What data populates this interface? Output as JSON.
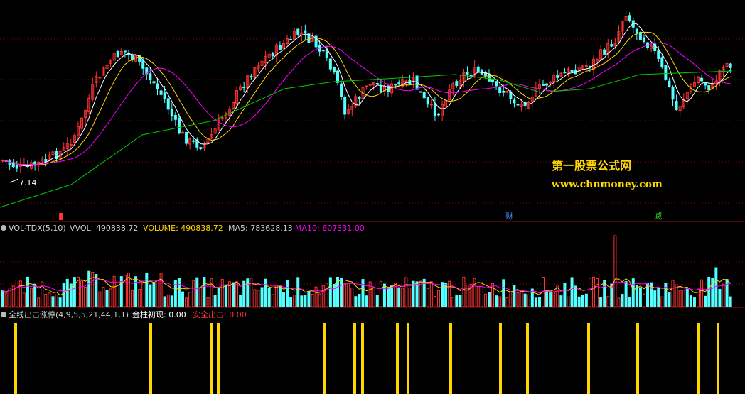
{
  "colors": {
    "background": "#000000",
    "up": "#ff3333",
    "down": "#54ffff",
    "ma_white": "#ffffff",
    "ma_yellow": "#ffd700",
    "ma_magenta": "#ff00ff",
    "ma_green": "#00cc00",
    "grid": "#8b0000",
    "separator": "#9e1010",
    "signal": "#ffd700"
  },
  "watermark": {
    "name": "第一股票公式网",
    "url": "www.chnmoney.com"
  },
  "main_panel": {
    "low_marker": "7.14",
    "event_markers": [
      {
        "label": "财",
        "color": "#3c8cff"
      },
      {
        "label": "减",
        "color": "#33dd33"
      }
    ]
  },
  "vol_panel": {
    "name": "VOL-TDX(5,10)",
    "items": [
      {
        "label": "VVOL: 490838.72",
        "color": "#cccccc"
      },
      {
        "label": "VOLUME: 490838.72",
        "color": "#ffd700"
      },
      {
        "label": "MA5: 783628.13",
        "color": "#cccccc"
      },
      {
        "label": "MA10: 607331.00",
        "color": "#ff00ff"
      }
    ]
  },
  "signal_panel": {
    "name": "全线出击涨停(4,9,5,5,21,44,1,1)",
    "items": [
      {
        "label": "金柱初现: 0.00",
        "color": "#ffffff"
      },
      {
        "label": "安全出击: 0.00",
        "color": "#ff3333"
      }
    ]
  },
  "chart_data": [
    {
      "type": "candlestick",
      "panel": "price",
      "title": "",
      "labels": [
        "7.14"
      ],
      "series_count": 4,
      "moving_averages": 4
    },
    {
      "type": "bar",
      "panel": "volume",
      "title": "VOL-TDX(5,10)",
      "series": [
        {
          "name": "VVOL",
          "last": 490838.72
        },
        {
          "name": "VOLUME",
          "last": 490838.72
        },
        {
          "name": "MA5",
          "last": 783628.13
        },
        {
          "name": "MA10",
          "last": 607331.0
        }
      ]
    },
    {
      "type": "bar",
      "panel": "signal",
      "title": "全线出击涨停(4,9,5,5,21,44,1,1)",
      "series": [
        {
          "name": "金柱初现",
          "last": 0.0
        },
        {
          "name": "安全出击",
          "last": 0.0
        }
      ],
      "signal_bar_index": [
        1,
        14,
        21,
        22,
        31,
        34,
        35,
        39,
        41,
        44,
        49,
        52,
        57,
        62,
        68,
        70
      ]
    }
  ]
}
